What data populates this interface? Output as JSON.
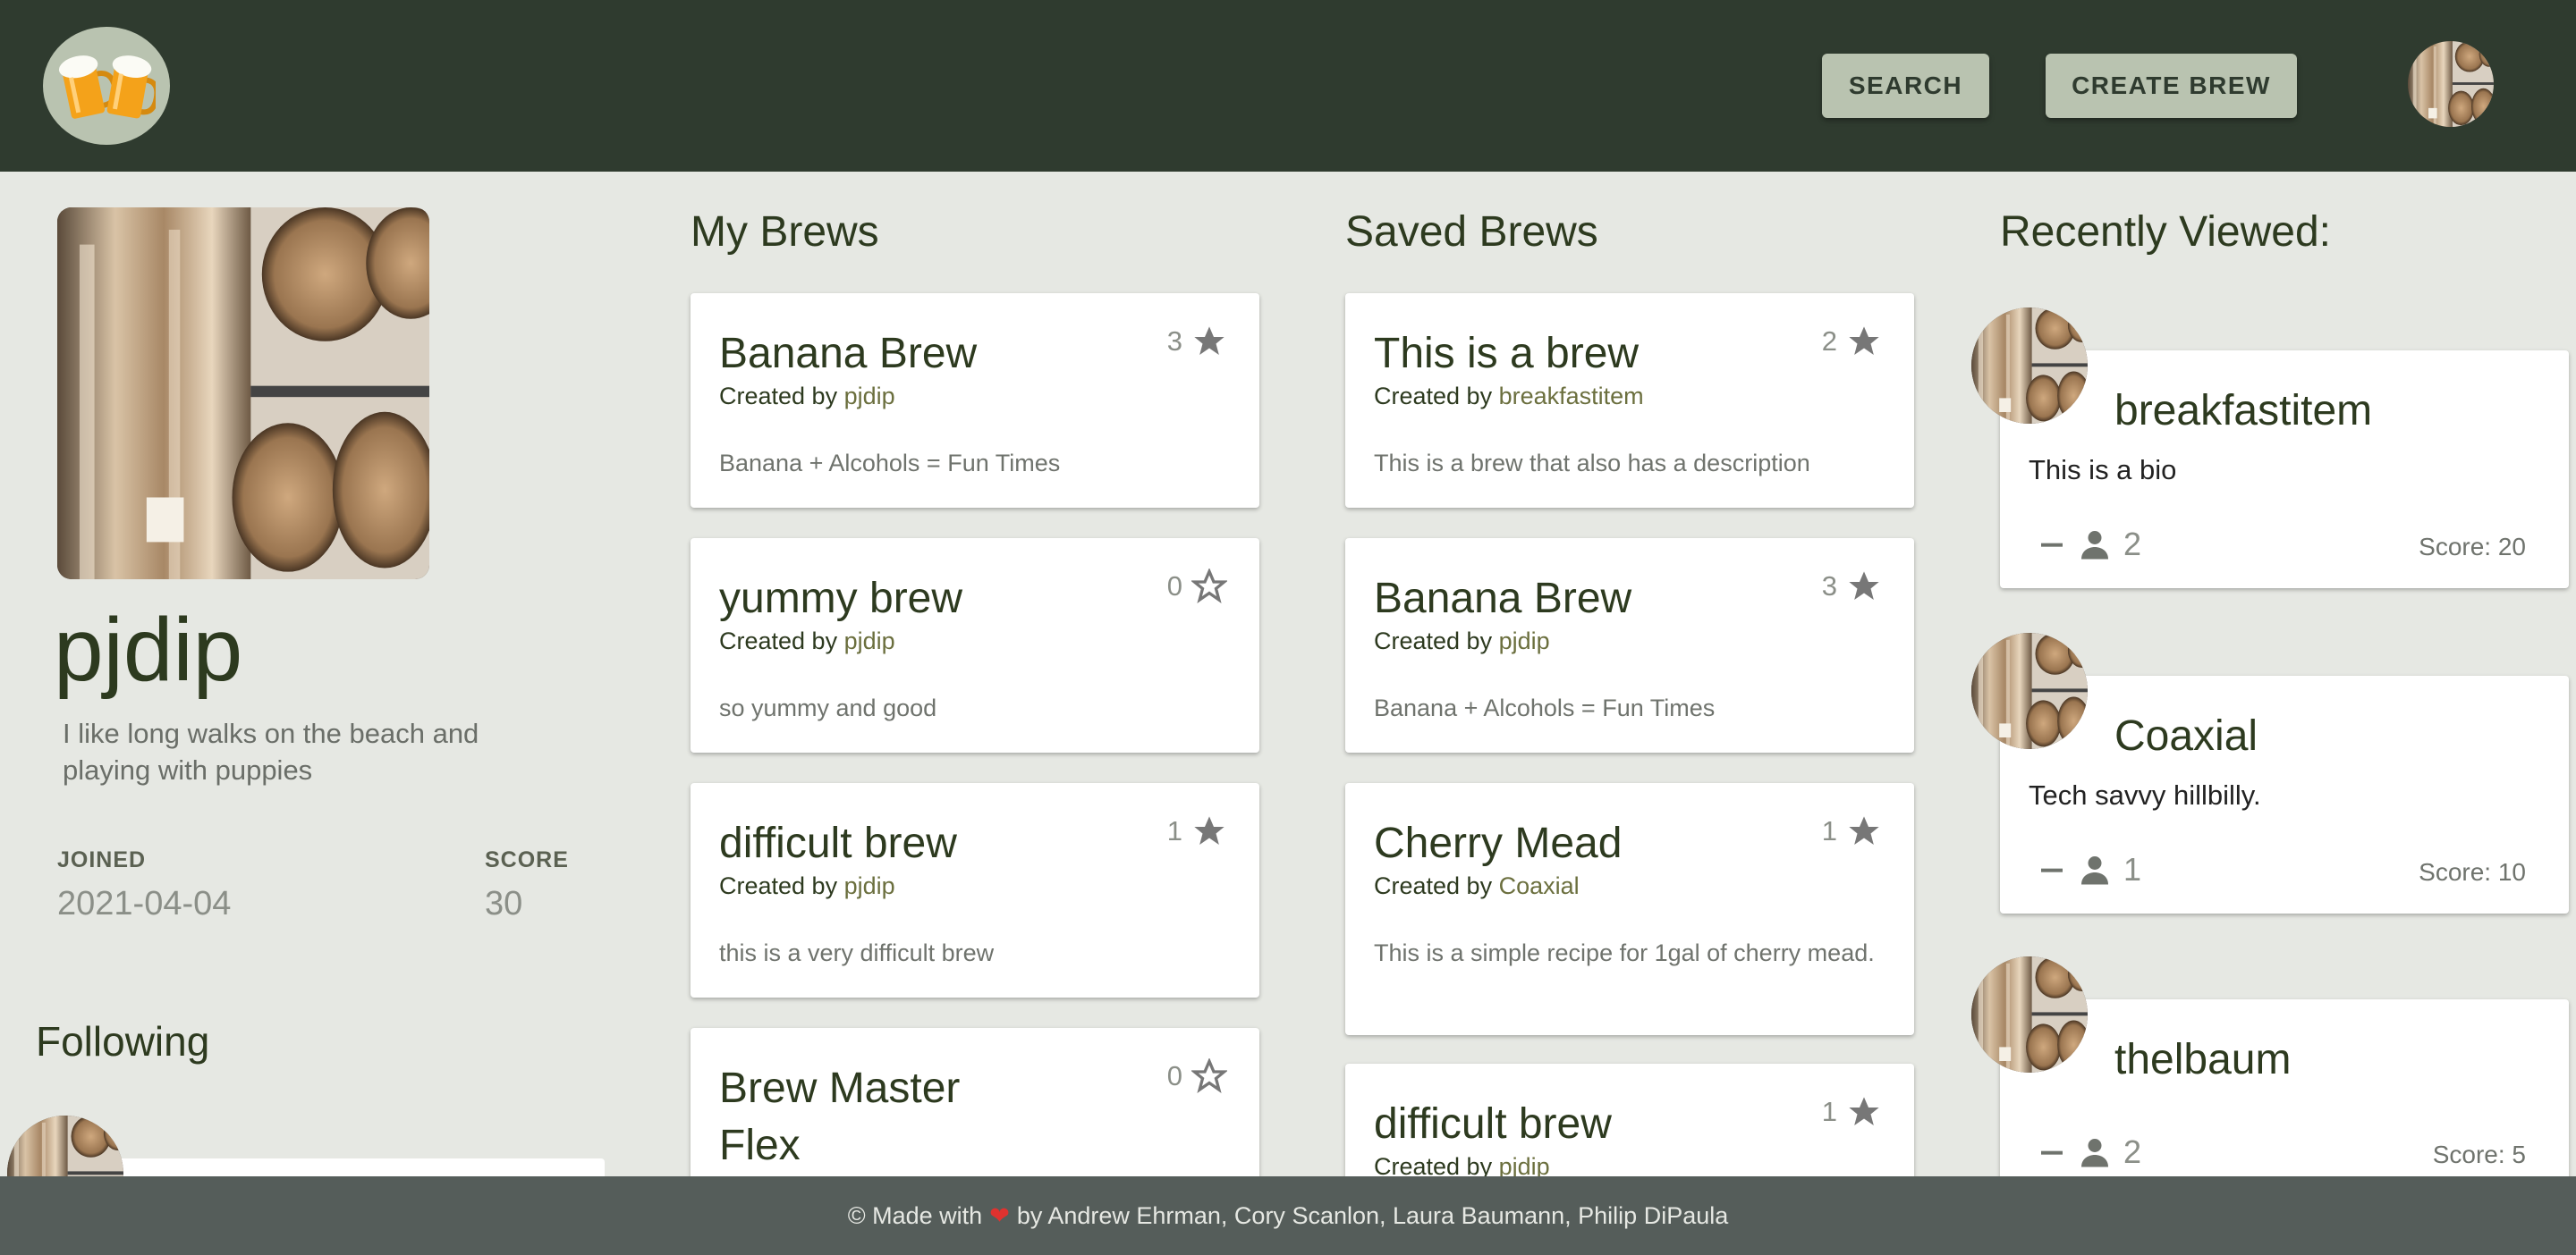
{
  "header": {
    "logo_icon": "beer-mugs-icon",
    "search_label": "SEARCH",
    "create_label": "CREATE BREW",
    "avatar_icon": "user-avatar-icon"
  },
  "profile": {
    "username": "pjdip",
    "bio": "I like long walks on the beach and playing with puppies",
    "joined_label": "JOINED",
    "joined_value": "2021-04-04",
    "score_label": "SCORE",
    "score_value": "30",
    "following_title": "Following"
  },
  "my_brews": {
    "title": "My Brews",
    "cards": [
      {
        "title": "Banana Brew",
        "stars": "3",
        "starred": true,
        "created_prefix": "Created by ",
        "author": "pjdip",
        "description": "Banana + Alcohols = Fun Times"
      },
      {
        "title": "yummy brew",
        "stars": "0",
        "starred": false,
        "created_prefix": "Created by ",
        "author": "pjdip",
        "description": "so yummy and good"
      },
      {
        "title": "difficult brew",
        "stars": "1",
        "starred": true,
        "created_prefix": "Created by ",
        "author": "pjdip",
        "description": "this is a very difficult brew"
      },
      {
        "title": "Brew Master Flex",
        "stars": "0",
        "starred": false
      }
    ]
  },
  "saved_brews": {
    "title": "Saved Brews",
    "cards": [
      {
        "title": "This is a brew",
        "stars": "2",
        "starred": true,
        "created_prefix": "Created by ",
        "author": "breakfastitem",
        "description": "This is a brew that also has a description"
      },
      {
        "title": "Banana Brew",
        "stars": "3",
        "starred": true,
        "created_prefix": "Created by ",
        "author": "pjdip",
        "description": "Banana + Alcohols = Fun Times"
      },
      {
        "title": "Cherry Mead",
        "stars": "1",
        "starred": true,
        "created_prefix": "Created by ",
        "author": "Coaxial",
        "description": "This is a simple recipe for 1gal of cherry mead."
      },
      {
        "title": "difficult brew",
        "stars": "1",
        "starred": true,
        "created_prefix": "Created by ",
        "author": "pjdip"
      }
    ]
  },
  "recently_viewed": {
    "title": "Recently Viewed:",
    "users": [
      {
        "name": "breakfastitem",
        "bio": "This is a bio",
        "followers": "2",
        "score": "Score: 20"
      },
      {
        "name": "Coaxial",
        "bio": "Tech savvy hillbilly.",
        "followers": "1",
        "score": "Score: 10"
      },
      {
        "name": "thelbaum",
        "bio": "",
        "followers": "2",
        "score": "Score: 5"
      }
    ]
  },
  "footer": {
    "prefix": "© Made with",
    "heart": "❤",
    "suffix": "by Andrew Ehrman, Cory Scanlon, Laura Baumann, Philip DiPaula"
  }
}
